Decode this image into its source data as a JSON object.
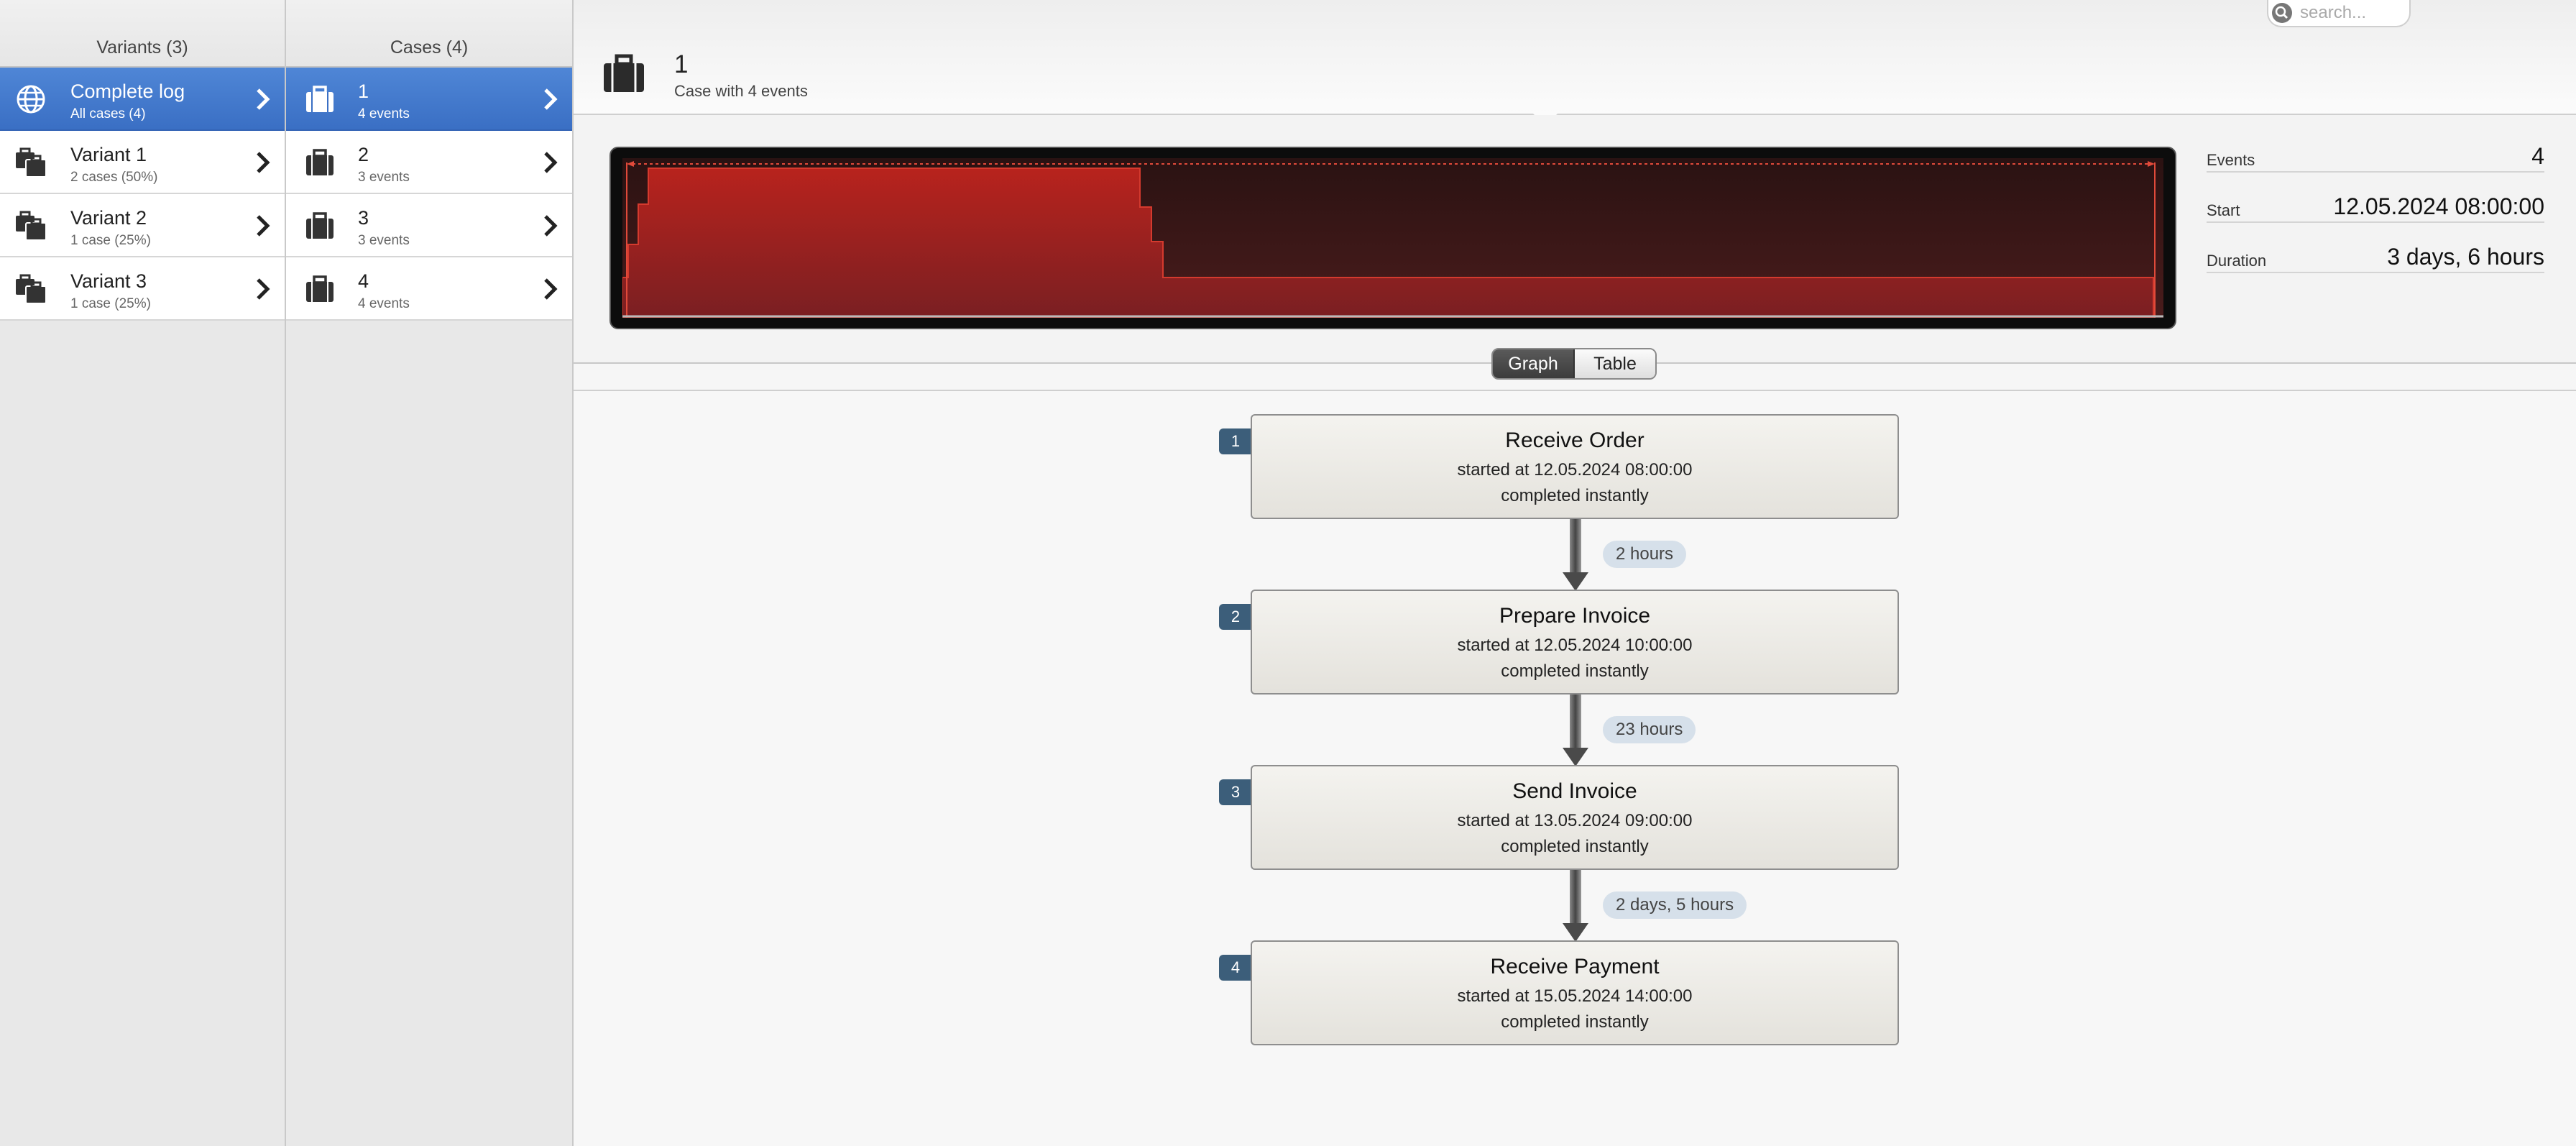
{
  "variants": {
    "header": "Variants (3)",
    "items": [
      {
        "title": "Complete log",
        "sub": "All cases (4)",
        "icon": "globe-icon",
        "selected": true
      },
      {
        "title": "Variant 1",
        "sub": "2 cases (50%)",
        "icon": "briefcases-icon",
        "selected": false
      },
      {
        "title": "Variant 2",
        "sub": "1 case (25%)",
        "icon": "briefcases-icon",
        "selected": false
      },
      {
        "title": "Variant 3",
        "sub": "1 case (25%)",
        "icon": "briefcases-icon",
        "selected": false
      }
    ]
  },
  "cases": {
    "header": "Cases (4)",
    "items": [
      {
        "title": "1",
        "sub": "4 events",
        "icon": "briefcase-icon",
        "selected": true
      },
      {
        "title": "2",
        "sub": "3 events",
        "icon": "briefcase-icon",
        "selected": false
      },
      {
        "title": "3",
        "sub": "3 events",
        "icon": "briefcase-icon",
        "selected": false
      },
      {
        "title": "4",
        "sub": "4 events",
        "icon": "briefcase-icon",
        "selected": false
      }
    ]
  },
  "case_header": {
    "title": "1",
    "subtitle": "Case with 4 events"
  },
  "search": {
    "placeholder": "search..."
  },
  "stats": {
    "events_label": "Events",
    "events_value": "4",
    "start_label": "Start",
    "start_value": "12.05.2024 08:00:00",
    "duration_label": "Duration",
    "duration_value": "3 days, 6 hours"
  },
  "view_toggle": {
    "graph_label": "Graph",
    "table_label": "Table",
    "active": "Graph"
  },
  "events": [
    {
      "index": "1",
      "name": "Receive Order",
      "start": "started at 12.05.2024 08:00:00",
      "completion": "completed instantly"
    },
    {
      "index": "2",
      "name": "Prepare Invoice",
      "start": "started at 12.05.2024 10:00:00",
      "completion": "completed instantly"
    },
    {
      "index": "3",
      "name": "Send Invoice",
      "start": "started at 13.05.2024 09:00:00",
      "completion": "completed instantly"
    },
    {
      "index": "4",
      "name": "Receive Payment",
      "start": "started at 15.05.2024 14:00:00",
      "completion": "completed instantly"
    }
  ],
  "durations": [
    "2 hours",
    "23 hours",
    "2 days, 5 hours"
  ],
  "colors": {
    "selection": "#3f75c9",
    "badge": "#3c5e7a",
    "timeline_fill": "#a3201c"
  }
}
